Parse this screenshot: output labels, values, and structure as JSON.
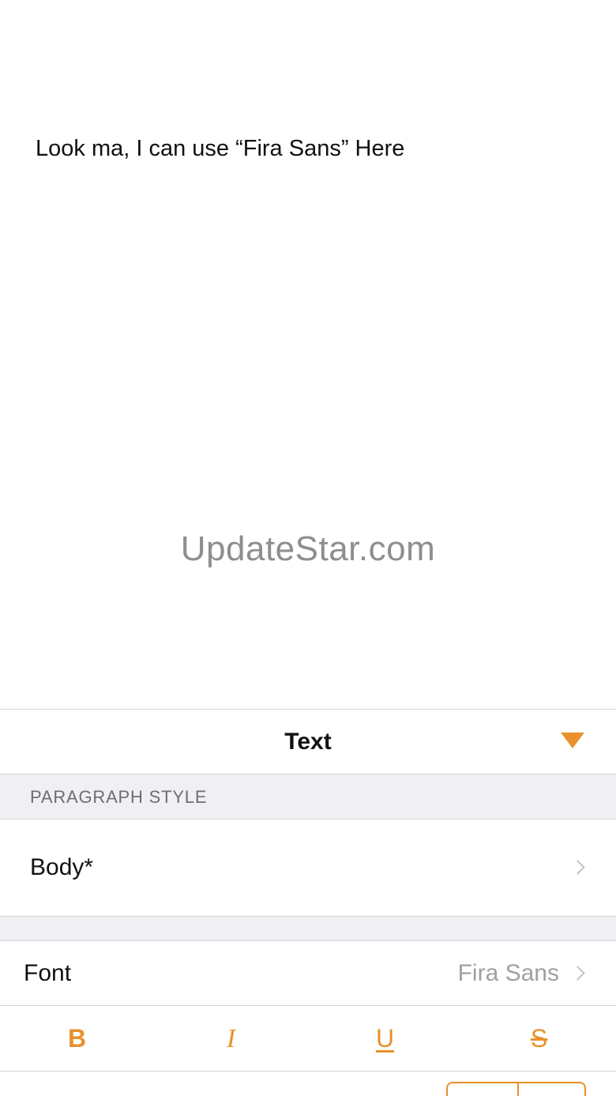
{
  "document": {
    "body_text": "Look ma, I can use “Fira Sans” Here"
  },
  "watermark": "UpdateStar.com",
  "panel": {
    "title": "Text",
    "collapse_icon": "triangle-down-icon",
    "paragraph_style": {
      "section_title": "PARAGRAPH STYLE",
      "value": "Body*"
    },
    "font": {
      "label": "Font",
      "value": "Fira Sans"
    },
    "format_buttons": {
      "bold": "B",
      "italic": "I",
      "underline": "U",
      "strikethrough": "S"
    }
  },
  "colors": {
    "accent": "#e8912d",
    "group_background": "#efeff4",
    "secondary_text": "#a0a0a5",
    "separator": "#d4d4d6"
  }
}
